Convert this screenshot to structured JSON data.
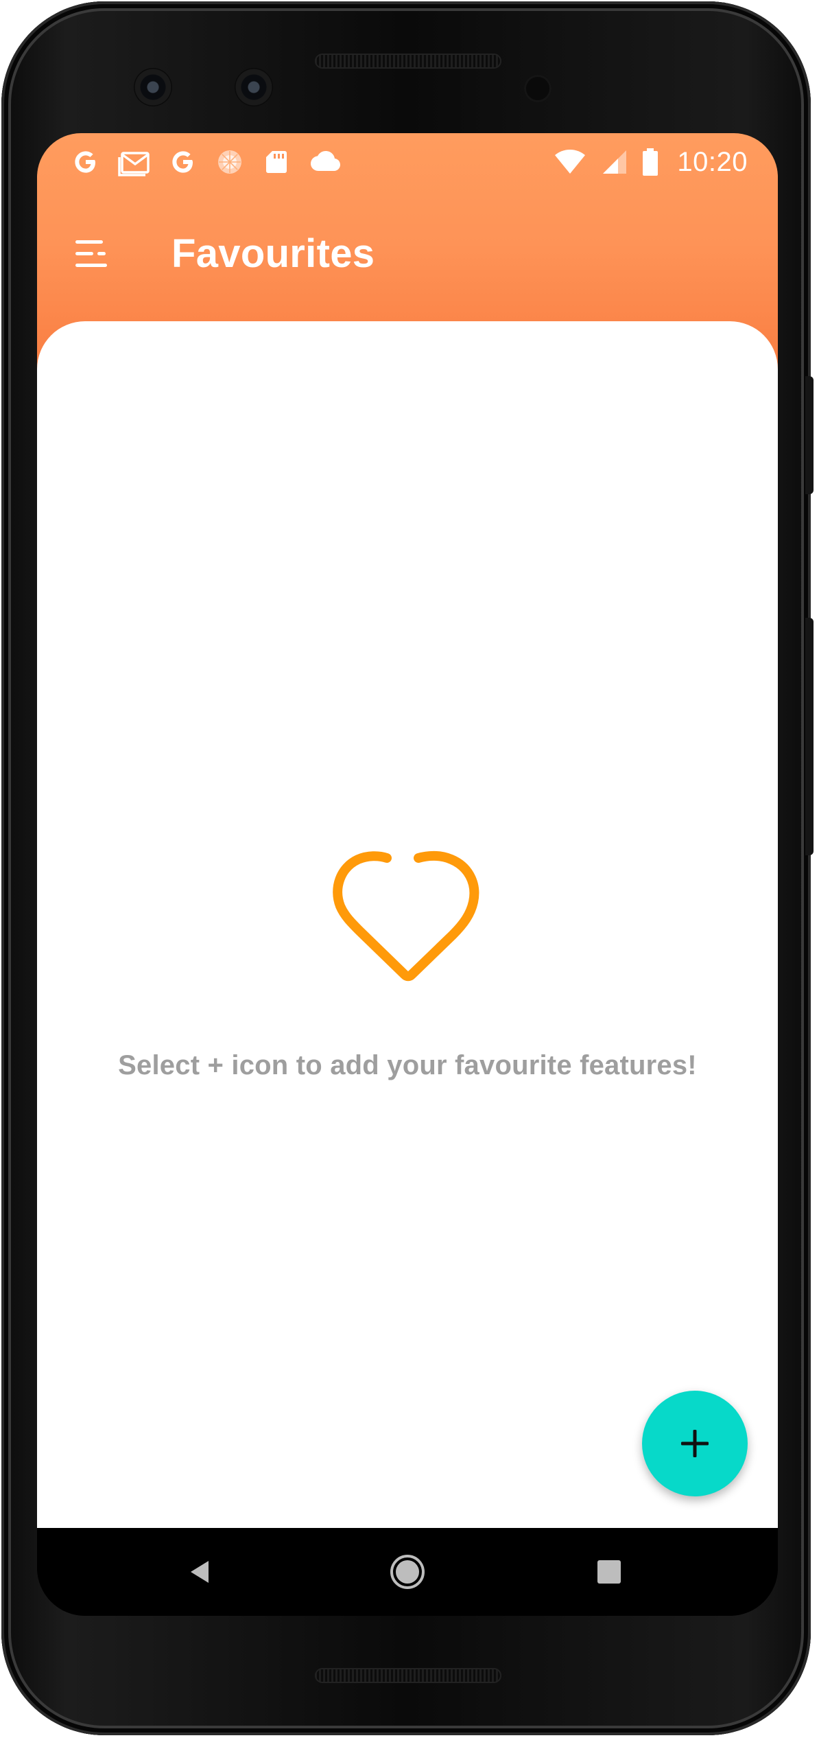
{
  "colors": {
    "header_top": "#ff9c5e",
    "header_bottom": "#f97c40",
    "accent_heart": "#ff9a0a",
    "fab": "#07d9c9",
    "empty_text": "#9e9e9e"
  },
  "status_bar": {
    "left_icons": [
      "google-icon",
      "gmail-icon",
      "google-icon",
      "sync-icon",
      "sd-card-icon",
      "cloud-icon"
    ],
    "right_icons": [
      "wifi-icon",
      "cell-signal-icon",
      "battery-icon"
    ],
    "time": "10:20"
  },
  "toolbar": {
    "menu_icon": "menu-icon",
    "title": "Favourites"
  },
  "empty_state": {
    "icon": "heart-outline-icon",
    "message": "Select + icon to add your favourite features!"
  },
  "fab": {
    "icon": "plus-icon"
  },
  "nav_bar": {
    "buttons": [
      "back-icon",
      "home-icon",
      "recents-icon"
    ]
  }
}
